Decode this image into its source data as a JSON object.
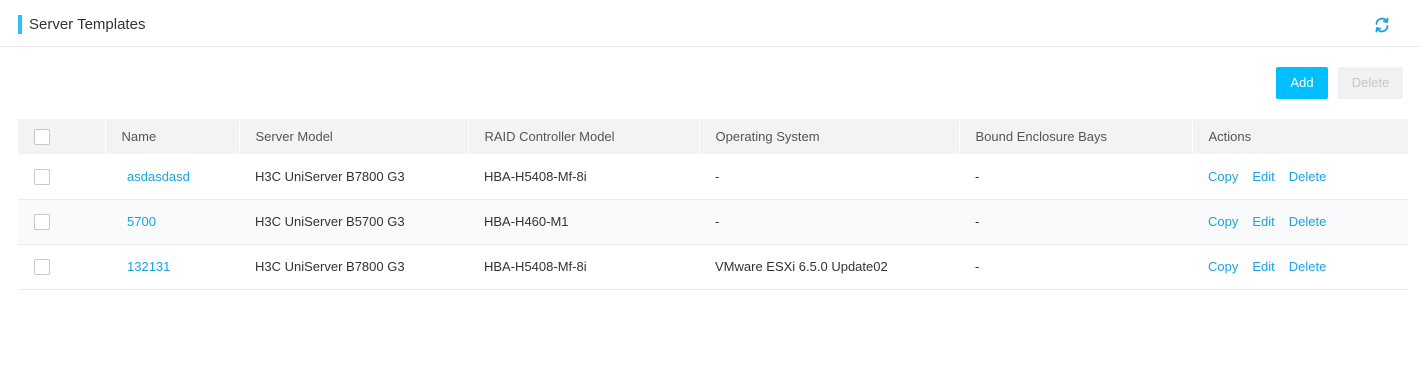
{
  "header": {
    "title": "Server Templates",
    "refresh_icon": "refresh-icon",
    "accent": "#2cc1f5"
  },
  "toolbar": {
    "add_label": "Add",
    "delete_label": "Delete"
  },
  "table": {
    "columns": [
      "Name",
      "Server Model",
      "RAID Controller Model",
      "Operating System",
      "Bound Enclosure Bays",
      "Actions"
    ],
    "rows": [
      {
        "name": "asdasdasd",
        "server_model": "H3C UniServer B7800 G3",
        "raid": "HBA-H5408-Mf-8i",
        "os": "-",
        "bays": "-"
      },
      {
        "name": "5700",
        "server_model": "H3C UniServer B5700 G3",
        "raid": "HBA-H460-M1",
        "os": "-",
        "bays": "-"
      },
      {
        "name": "132131",
        "server_model": "H3C UniServer B7800 G3",
        "raid": "HBA-H5408-Mf-8i",
        "os": "VMware ESXi 6.5.0 Update02",
        "bays": "-"
      }
    ],
    "actions": {
      "copy": "Copy",
      "edit": "Edit",
      "delete": "Delete"
    }
  }
}
